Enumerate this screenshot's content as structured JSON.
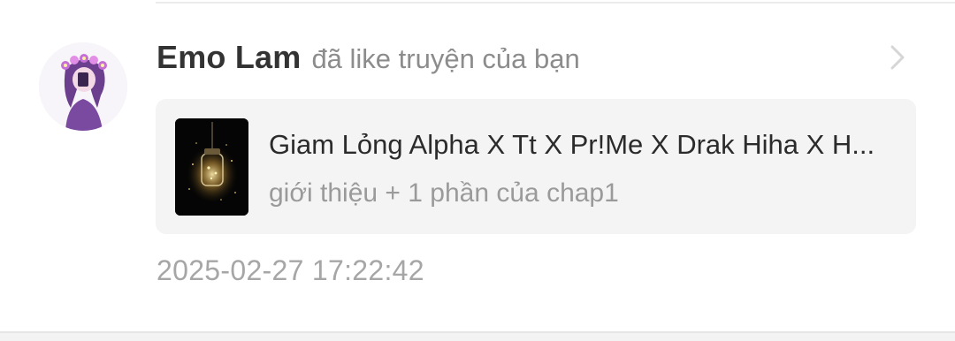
{
  "notification": {
    "user_name": "Emo Lam",
    "action": "đã like truyện của bạn",
    "story": {
      "title": "Giam Lỏng Alpha X Tt X Pr!Me X Drak Hiha X H...",
      "subtitle": "giới thiệu + 1 phần của chap1"
    },
    "timestamp": "2025-02-27 17:22:42"
  },
  "icons": {
    "avatar": "user-avatar-anime-girl",
    "chevron": "chevron-right-icon",
    "cover": "glowing-jar-cover"
  },
  "colors": {
    "name": "#333333",
    "secondary_text": "#8c8c8c",
    "card_background": "#f4f4f5",
    "timestamp": "#a6a6a6"
  }
}
